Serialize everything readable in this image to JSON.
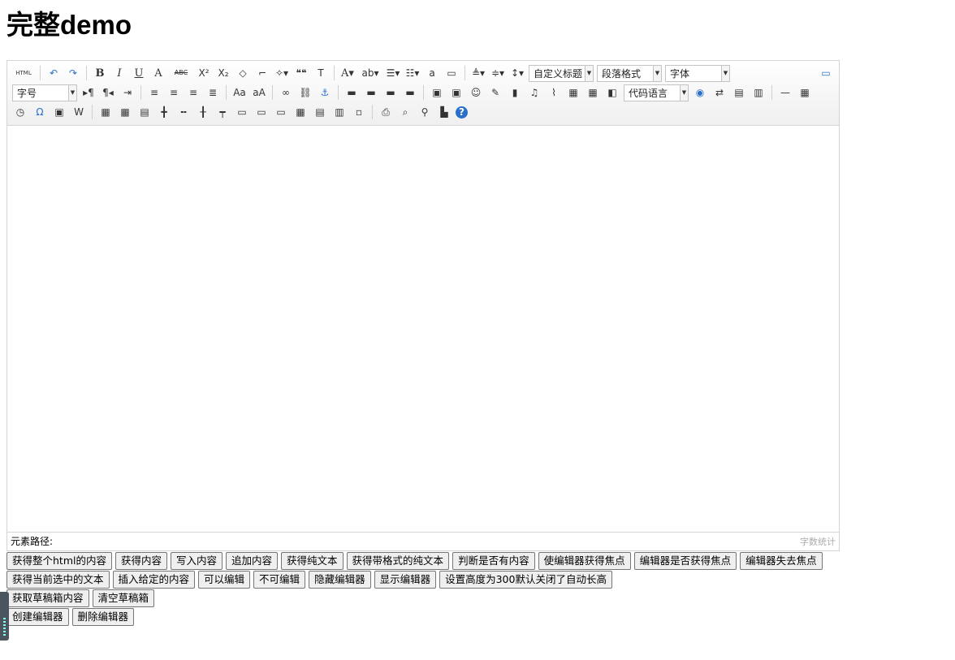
{
  "page": {
    "title": "完整demo"
  },
  "toolbar": {
    "row1": [
      {
        "icon": "source-html-icon",
        "text": "HTML"
      },
      {
        "sep": true
      },
      {
        "icon": "undo-icon",
        "text": "↶"
      },
      {
        "icon": "redo-icon",
        "text": "↷"
      },
      {
        "sep": true
      },
      {
        "icon": "bold-icon",
        "text": "B"
      },
      {
        "icon": "italic-icon",
        "text": "I"
      },
      {
        "icon": "underline-icon",
        "text": "U"
      },
      {
        "icon": "font-border-icon",
        "text": "A"
      },
      {
        "icon": "strikethrough-icon",
        "text": "ABC"
      },
      {
        "icon": "superscript-icon",
        "text": "X²"
      },
      {
        "icon": "subscript-icon",
        "text": "X₂"
      },
      {
        "icon": "eraser-icon",
        "text": "◇"
      },
      {
        "icon": "format-match-icon",
        "text": "⌐"
      },
      {
        "icon": "auto-typeset-icon",
        "text": "✧▾"
      },
      {
        "icon": "blockquote-icon",
        "text": "❝❝"
      },
      {
        "icon": "paste-plain-icon",
        "text": "T"
      },
      {
        "sep": true
      },
      {
        "icon": "forecolor-icon",
        "text": "A▾"
      },
      {
        "icon": "backcolor-icon",
        "text": "ab▾"
      },
      {
        "icon": "ordered-list-icon",
        "text": "☰▾"
      },
      {
        "icon": "unordered-list-icon",
        "text": "☷▾"
      },
      {
        "icon": "select-all-icon",
        "text": "a"
      },
      {
        "icon": "clear-doc-icon",
        "text": "▭"
      },
      {
        "sep": true
      },
      {
        "icon": "row-spacing-top-icon",
        "text": "≜▾"
      },
      {
        "icon": "row-spacing-bottom-icon",
        "text": "≑▾"
      },
      {
        "icon": "line-height-icon",
        "text": "↕▾"
      }
    ],
    "selects": {
      "custom_heading": "自定义标题",
      "paragraph": "段落格式",
      "font_family": "字体",
      "font_size": "字号",
      "code_language": "代码语言"
    },
    "row2": [
      {
        "icon": "direction-ltr-icon",
        "text": "▸¶"
      },
      {
        "icon": "direction-rtl-icon",
        "text": "¶◂"
      },
      {
        "icon": "indent-icon",
        "text": "⇥"
      },
      {
        "sep": true
      },
      {
        "icon": "align-left-icon",
        "text": "≡"
      },
      {
        "icon": "align-center-icon",
        "text": "≡"
      },
      {
        "icon": "align-right-icon",
        "text": "≡"
      },
      {
        "icon": "align-justify-icon",
        "text": "≣"
      },
      {
        "sep": true
      },
      {
        "icon": "to-uppercase-icon",
        "text": "Aa"
      },
      {
        "icon": "to-lowercase-icon",
        "text": "aA"
      },
      {
        "sep": true
      },
      {
        "icon": "link-icon",
        "text": "∞"
      },
      {
        "icon": "unlink-icon",
        "text": "⛓"
      },
      {
        "icon": "anchor-icon",
        "text": "⚓"
      },
      {
        "sep": true
      },
      {
        "icon": "image-none-icon",
        "text": "▬"
      },
      {
        "icon": "image-left-icon",
        "text": "▬"
      },
      {
        "icon": "image-right-icon",
        "text": "▬"
      },
      {
        "icon": "image-center-icon",
        "text": "▬"
      },
      {
        "sep": true
      },
      {
        "icon": "simple-upload-icon",
        "text": "▣"
      },
      {
        "icon": "insert-image-icon",
        "text": "▣"
      },
      {
        "icon": "emotion-icon",
        "text": "☺"
      },
      {
        "icon": "scrawl-icon",
        "text": "✎"
      },
      {
        "icon": "insert-video-icon",
        "text": "▮"
      },
      {
        "icon": "music-icon",
        "text": "♫"
      },
      {
        "icon": "attachment-icon",
        "text": "⌇"
      },
      {
        "icon": "map-icon",
        "text": "▦"
      },
      {
        "icon": "gmap-icon",
        "text": "▦"
      },
      {
        "icon": "insert-frame-icon",
        "text": "◧"
      }
    ],
    "row2_after_code": [
      {
        "icon": "web-app-icon",
        "text": "◉"
      },
      {
        "icon": "page-break-icon",
        "text": "⇄"
      },
      {
        "icon": "template-icon",
        "text": "▤"
      },
      {
        "icon": "background-icon",
        "text": "▥"
      },
      {
        "sep": true
      },
      {
        "icon": "horizontal-rule-icon",
        "text": "—"
      },
      {
        "icon": "date-icon",
        "text": "▦"
      }
    ],
    "row3": [
      {
        "icon": "time-icon",
        "text": "◷"
      },
      {
        "icon": "special-chars-icon",
        "text": "Ω"
      },
      {
        "icon": "snapscreen-icon",
        "text": "▣"
      },
      {
        "icon": "word-image-icon",
        "text": "W"
      },
      {
        "sep": true
      },
      {
        "icon": "insert-table-icon",
        "text": "▦"
      },
      {
        "icon": "delete-table-icon",
        "text": "▦"
      },
      {
        "icon": "insert-paragraph-before-table-icon",
        "text": "▤"
      },
      {
        "icon": "insert-row-icon",
        "text": "╋"
      },
      {
        "icon": "delete-row-icon",
        "text": "╍"
      },
      {
        "icon": "insert-col-icon",
        "text": "╂"
      },
      {
        "icon": "delete-col-icon",
        "text": "┯"
      },
      {
        "icon": "merge-cells-icon",
        "text": "▭"
      },
      {
        "icon": "merge-right-icon",
        "text": "▭"
      },
      {
        "icon": "merge-down-icon",
        "text": "▭"
      },
      {
        "icon": "split-to-cells-icon",
        "text": "▦"
      },
      {
        "icon": "split-to-rows-icon",
        "text": "▤"
      },
      {
        "icon": "split-to-cols-icon",
        "text": "▥"
      },
      {
        "icon": "charts-icon",
        "text": "▫"
      },
      {
        "sep": true
      },
      {
        "icon": "print-icon",
        "text": "⎙"
      },
      {
        "icon": "preview-icon",
        "text": "⌕"
      },
      {
        "icon": "search-replace-icon",
        "text": "⚲"
      },
      {
        "icon": "drafts-icon",
        "text": "▙"
      },
      {
        "icon": "help-icon",
        "text": "?"
      }
    ]
  },
  "status": {
    "path_label": "元素路径:",
    "word_count": "字数统计"
  },
  "buttons": {
    "row1": [
      "获得整个html的内容",
      "获得内容",
      "写入内容",
      "追加内容",
      "获得纯文本",
      "获得带格式的纯文本",
      "判断是否有内容",
      "使编辑器获得焦点",
      "编辑器是否获得焦点",
      "编辑器失去焦点"
    ],
    "row2": [
      "获得当前选中的文本",
      "插入给定的内容",
      "可以编辑",
      "不可编辑",
      "隐藏编辑器",
      "显示编辑器",
      "设置高度为300默认关闭了自动长高"
    ],
    "row3": [
      "获取草稿箱内容",
      "清空草稿箱"
    ],
    "row4": [
      "创建编辑器",
      "删除编辑器"
    ]
  },
  "colors": {
    "toolbar_bg": "#f0f0f0",
    "border": "#d4d4d4",
    "icon_blue": "#2a6fc9"
  }
}
